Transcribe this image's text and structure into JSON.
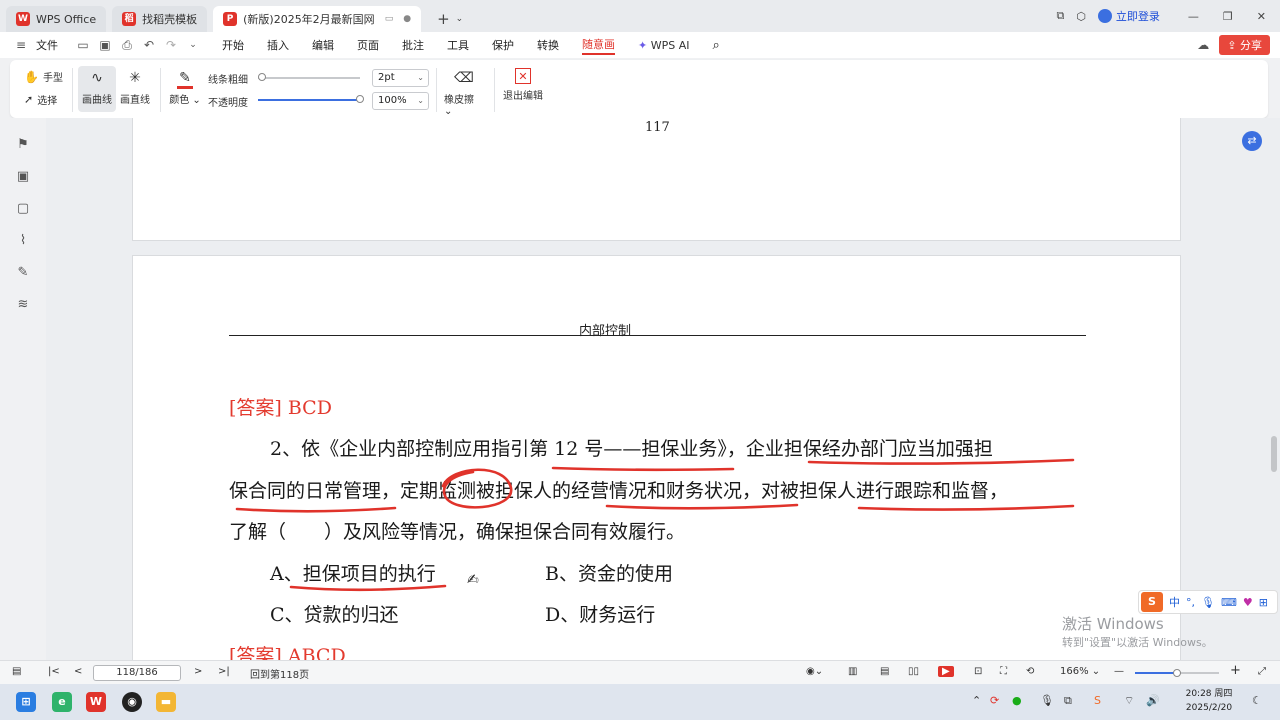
{
  "titlebar": {
    "tabs": [
      {
        "label": "WPS Office",
        "icon": "wps-logo-icon",
        "color": "#e0332b"
      },
      {
        "label": "找稻壳模板",
        "icon": "template-icon",
        "color": "#e0332b"
      },
      {
        "label": "(新版)2025年2月最新国网",
        "icon": "pdf-icon",
        "color": "#e0332b"
      }
    ],
    "login_label": "立即登录"
  },
  "menubar": {
    "file_label": "文件",
    "menus": [
      "开始",
      "插入",
      "编辑",
      "页面",
      "批注",
      "工具",
      "保护",
      "转换",
      "随意画"
    ],
    "active_menu": "随意画",
    "wps_ai_label": "WPS AI",
    "share_label": "分享"
  },
  "ribbon": {
    "hand_label": "手型",
    "select_label": "选择",
    "curve_label": "画曲线",
    "line_label": "画直线",
    "color_label": "颜色",
    "thickness_label": "线条粗细",
    "opacity_label": "不透明度",
    "thickness_value": "2pt",
    "opacity_value": "100%",
    "eraser_label": "橡皮擦",
    "exit_label": "退出编辑",
    "pen_color": "#e0332b"
  },
  "document": {
    "prev_page_number": "117",
    "header_text": "内部控制",
    "answer1": "[答案] BCD",
    "q_line1": "2、依《企业内部控制应用指引第 12 号——担保业务》，企业担保经办部门应当加强担",
    "q_line2": "保合同的日常管理，定期监测被担保人的经营情况和财务状况，对被担保人进行跟踪和监督，",
    "q_line3": "了解（　　）及风险等情况，确保担保合同有效履行。",
    "option_a": "A、担保项目的执行",
    "option_b": "B、资金的使用",
    "option_c": "C、贷款的归还",
    "option_d": "D、财务运行",
    "answer2": "[答案] ABCD",
    "ink_color": "#e0332b"
  },
  "overlay": {
    "watermark_line1": "激活 Windows",
    "watermark_line2": "转到\"设置\"以激活 Windows。",
    "ime_label": "中"
  },
  "statusbar": {
    "page_indicator": "118/186",
    "back_label": "回到第118页",
    "zoom_label": "166%"
  },
  "taskbar": {
    "time": "20:28 周四",
    "date": "2025/2/20"
  }
}
